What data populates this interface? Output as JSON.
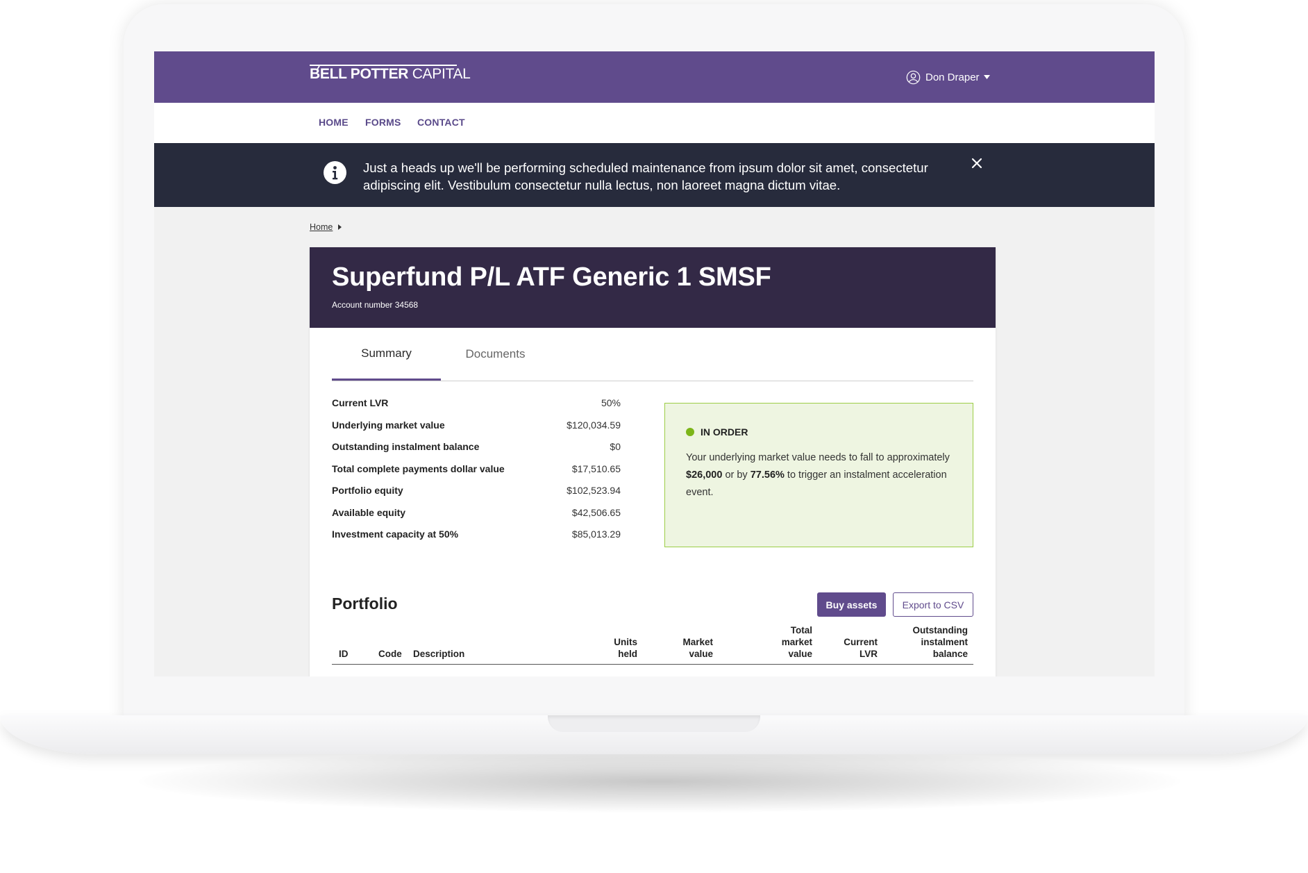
{
  "brand": {
    "name_bold": "BELL POTTER",
    "name_regular": " CAPITAL",
    "primary_color": "#604b8c",
    "dark_color": "#332946"
  },
  "user": {
    "name": "Don Draper",
    "icon": "user-circle-icon"
  },
  "nav": {
    "items": [
      {
        "label": "HOME"
      },
      {
        "label": "FORMS"
      },
      {
        "label": "CONTACT"
      }
    ]
  },
  "banner": {
    "icon": "info-icon",
    "message": "Just a heads up we'll be performing scheduled maintenance from ipsum dolor sit amet, consectetur adipiscing elit. Vestibulum consectetur nulla lectus, non laoreet magna dictum vitae.",
    "close_icon": "close-icon"
  },
  "breadcrumb": {
    "items": [
      {
        "label": "Home"
      }
    ]
  },
  "account": {
    "title": "Superfund P/L ATF Generic 1 SMSF",
    "number": "Account number 34568"
  },
  "tabs": [
    {
      "label": "Summary",
      "active": true
    },
    {
      "label": "Documents",
      "active": false
    }
  ],
  "summary": {
    "rows": [
      {
        "label": "Current LVR",
        "value": "50%"
      },
      {
        "label": "Underlying market value",
        "value": "$120,034.59"
      },
      {
        "label": "Outstanding instalment balance",
        "value": "$0"
      },
      {
        "label": "Total complete payments dollar value",
        "value": "$17,510.65"
      },
      {
        "label": "Portfolio equity",
        "value": "$102,523.94"
      },
      {
        "label": "Available equity",
        "value": "$42,506.65"
      },
      {
        "label": "Investment capacity at 50%",
        "value": "$85,013.29"
      }
    ]
  },
  "status": {
    "label": "IN ORDER",
    "color": "#7cb518",
    "text_1": "Your underlying market value needs to fall to approximately ",
    "amount": "$26,000",
    "text_2": " or by ",
    "percent": "77.56%",
    "text_3": " to trigger an instalment acceleration event."
  },
  "portfolio": {
    "title": "Portfolio",
    "buy_label": "Buy assets",
    "export_label": "Export to CSV",
    "columns": [
      "ID",
      "Code",
      "Description",
      "Units\nheld",
      "Market\nvalue",
      "Total\nmarket\nvalue",
      "Current\nLVR",
      "Outstanding\ninstalment\nbalance"
    ]
  }
}
